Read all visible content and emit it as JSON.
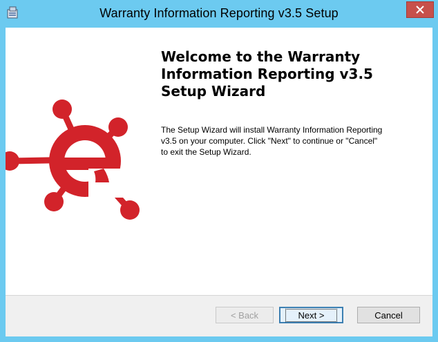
{
  "window": {
    "title": "Warranty Information Reporting v3.5 Setup",
    "app_icon": "installer-icon",
    "close_icon": "close-icon"
  },
  "welcome": {
    "heading": "Welcome to the Warranty\nInformation Reporting v3.5\nSetup Wizard",
    "description": "The Setup Wizard will install Warranty Information Reporting\nv3.5 on your computer.  Click \"Next\" to continue or \"Cancel\"\nto exit the Setup Wizard."
  },
  "logo": {
    "icon": "e-logo-icon",
    "color": "#d2232a"
  },
  "buttons": {
    "back_prefix": "< ",
    "back_label": "Back",
    "next_label": "Next >",
    "cancel_label": "Cancel"
  },
  "colors": {
    "titlebar": "#6ccaf0",
    "close": "#c7504b",
    "logo": "#d2232a"
  }
}
